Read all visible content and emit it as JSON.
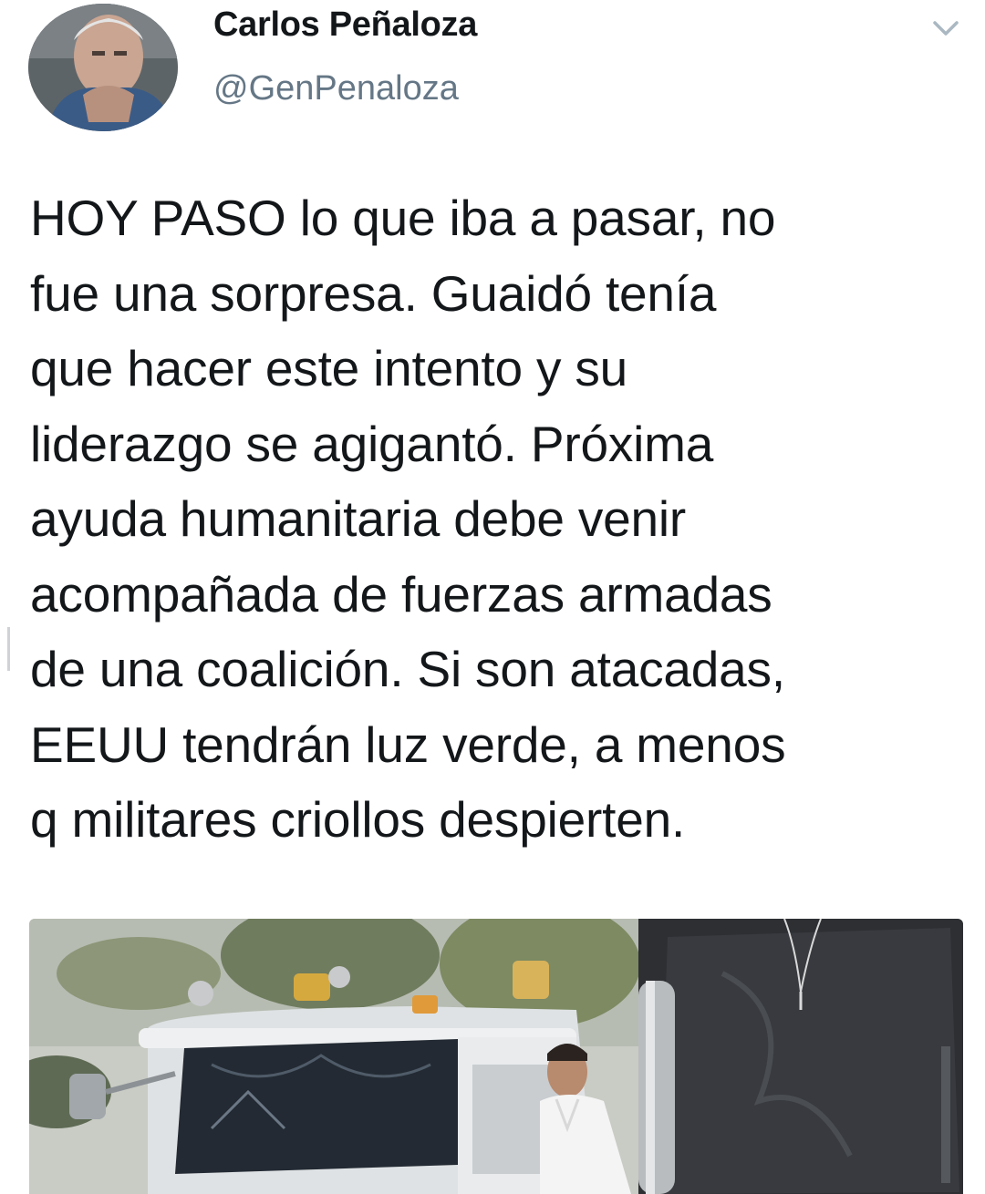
{
  "author": {
    "display_name": "Carlos Peñaloza",
    "handle": "@GenPenaloza"
  },
  "icons": {
    "menu": "chevron-down-icon",
    "avatar": "profile-photo"
  },
  "tweet": {
    "lines": [
      "HOY PASO lo que iba a pasar, no",
      "fue una sorpresa. Guaidó tenía",
      "que hacer este intento y su",
      "liderazgo se agigantó. Próxima",
      "ayuda humanitaria debe venir",
      "acompañada de fuerzas armadas",
      "de una coalición. Si son atacadas,",
      "EEUU tendrán luz verde, a menos",
      "q militares criollos despierten."
    ]
  },
  "colors": {
    "text": "#14171a",
    "secondary": "#657786",
    "background": "#ffffff"
  }
}
